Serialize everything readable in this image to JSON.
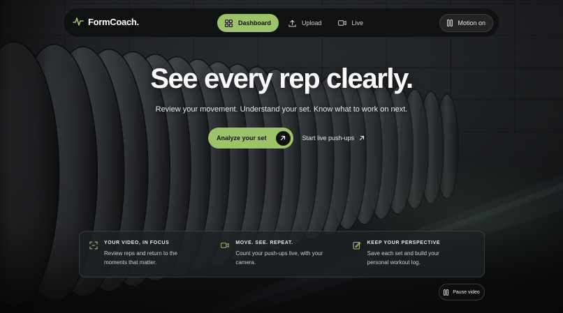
{
  "app": {
    "brand_name": "FormCoach.",
    "accent_color": "#9cc26a"
  },
  "nav": {
    "items": [
      {
        "label": "Dashboard",
        "icon": "dashboard-grid-icon",
        "active": true
      },
      {
        "label": "Upload",
        "icon": "upload-icon",
        "active": false
      },
      {
        "label": "Live",
        "icon": "video-camera-icon",
        "active": false
      }
    ],
    "motion_toggle_label": "Motion on",
    "motion_icon": "pause-icon"
  },
  "hero": {
    "title": "See every rep clearly.",
    "subtitle": "Review your movement. Understand your set. Know what to work on next.",
    "primary_cta": "Analyze your set",
    "primary_cta_icon": "arrow-up-right-icon",
    "secondary_cta": "Start live push-ups",
    "secondary_cta_icon": "arrow-up-right-icon"
  },
  "features": [
    {
      "icon": "focus-frame-icon",
      "title": "YOUR VIDEO, IN FOCUS",
      "description": "Review reps and return to the moments that matter."
    },
    {
      "icon": "video-camera-icon",
      "title": "MOVE. SEE. REPEAT.",
      "description": "Count your push-ups live, with your camera."
    },
    {
      "icon": "notebook-edit-icon",
      "title": "KEEP YOUR PERSPECTIVE",
      "description": "Save each set and build your personal workout log."
    }
  ],
  "video_control": {
    "label": "Pause video",
    "icon": "pause-icon"
  }
}
